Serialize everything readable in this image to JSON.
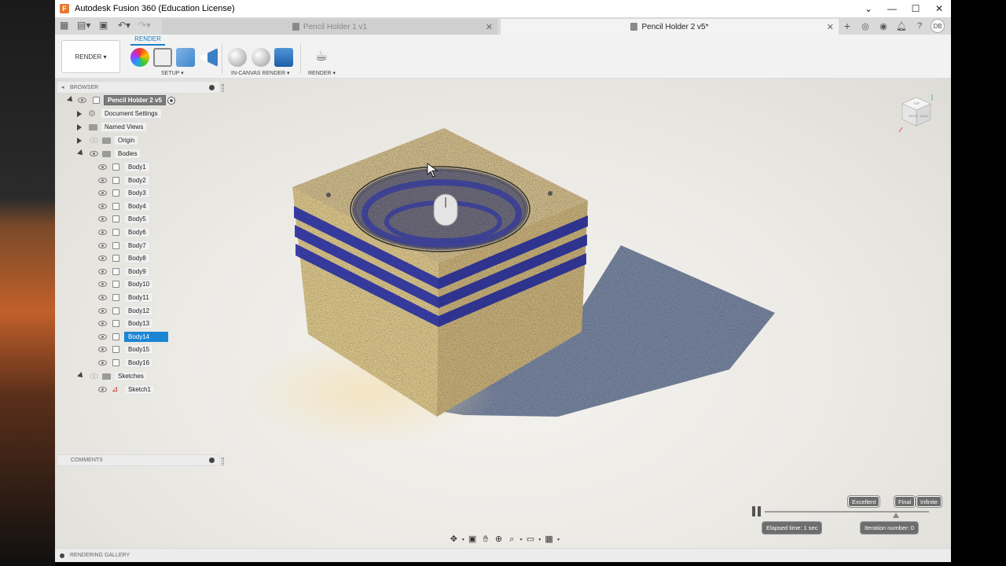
{
  "window": {
    "title": "Autodesk Fusion 360 (Education License)",
    "app_logo_letter": "F"
  },
  "tabs": [
    {
      "label": "Pencil Holder 1 v1",
      "active": false
    },
    {
      "label": "Pencil Holder 2 v5*",
      "active": true
    }
  ],
  "user": {
    "initials": "DB"
  },
  "ribbon": {
    "workspace_label": "RENDER",
    "active_tab": "RENDER",
    "groups": {
      "setup": "SETUP",
      "in_canvas": "IN-CANVAS RENDER",
      "render": "RENDER"
    }
  },
  "browser": {
    "header": "BROWSER",
    "root": "Pencil Holder 2 v5",
    "document_settings": "Document Settings",
    "named_views": "Named Views",
    "origin": "Origin",
    "bodies": "Bodies",
    "body_items": [
      "Body1",
      "Body2",
      "Body3",
      "Body4",
      "Body5",
      "Body6",
      "Body7",
      "Body8",
      "Body9",
      "Body10",
      "Body11",
      "Body12",
      "Body13",
      "Body14",
      "Body15",
      "Body16"
    ],
    "selected_body": "Body14",
    "sketches": "Sketches",
    "sketch_items": [
      "Sketch1"
    ]
  },
  "comments": {
    "label": "COMMENTS"
  },
  "render_progress": {
    "levels": [
      "Excellent",
      "Final",
      "Infinite"
    ],
    "elapsed": "Elapsed time: 1 sec",
    "iteration": "Iteration number: 0",
    "progress": 0.0
  },
  "viewcube": {
    "face_top": "TOP",
    "face_front": "RIGHT",
    "face_side": "BACK"
  },
  "gallery": {
    "label": "RENDERING GALLERY"
  },
  "colors": {
    "accent": "#1a86d4",
    "model_sand": "#d9c48a",
    "model_stripe": "#3a3fa8",
    "shadow": "#5e6f8e"
  }
}
